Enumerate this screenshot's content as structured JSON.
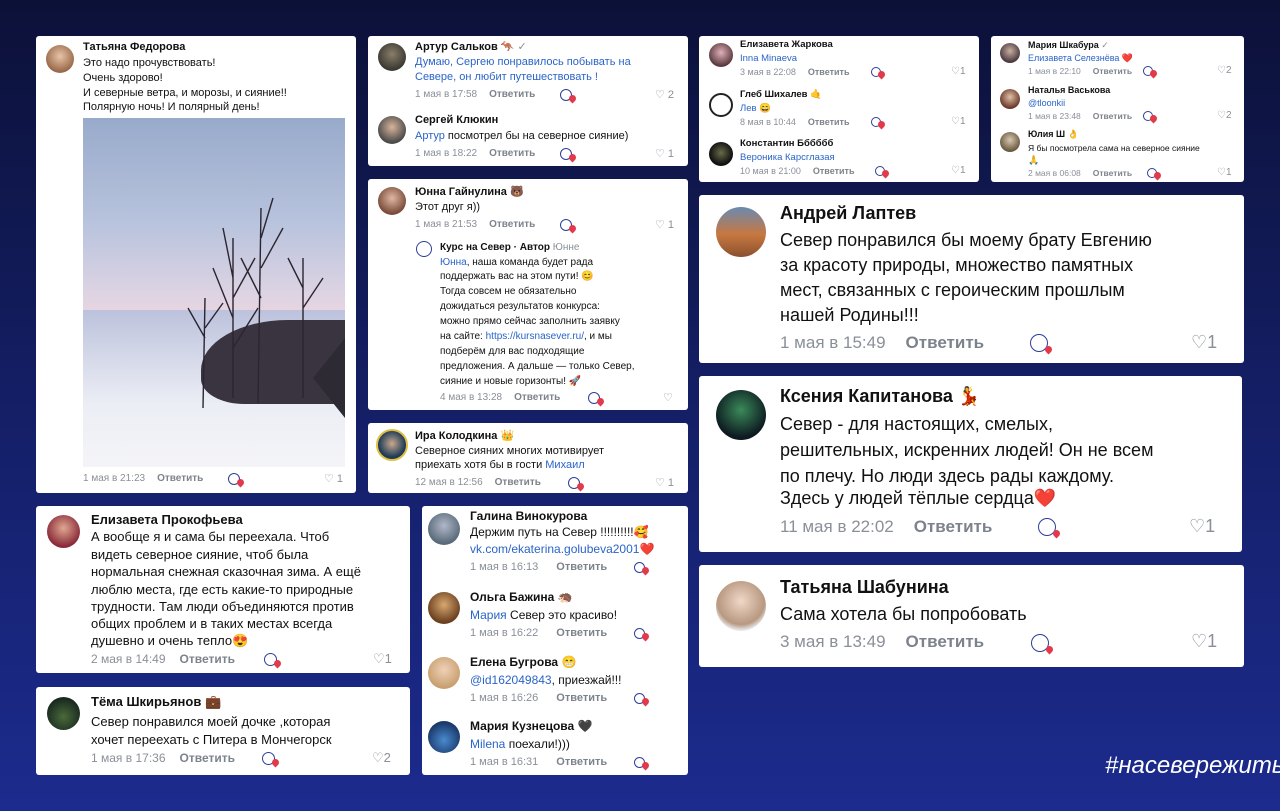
{
  "hashtag": "#насевережить",
  "reply_label": "Ответить",
  "c1": {
    "name": "Татьяна Федорова",
    "lines": [
      "Это надо прочувствовать!",
      "Очень здорово!",
      "И северные ветра, и морозы, и сияние!!",
      "Полярную ночь! И полярный день!"
    ],
    "date": "1 мая в 21:23",
    "likes": "1"
  },
  "c2a": {
    "name": "Артур Сальков",
    "line1": "Думаю, Сергею понравилось побывать на",
    "line2": "Севере, он любит путешествовать !",
    "date": "1 мая в 17:58",
    "likes": "2"
  },
  "c2b": {
    "name": "Сергей Клюкин",
    "mention": "Артур",
    "text": " посмотрел бы на северное сияние)",
    "date": "1 мая в 18:22",
    "likes": "1"
  },
  "c3": {
    "name": "Юнна Гайнулина",
    "text": "Этот друг я))",
    "date": "1 мая в 21:53",
    "likes": "1",
    "reply": {
      "name": "Курс на Север · Автор",
      "to": "Юнне",
      "mention": "Юнна",
      "lines": [
        ", наша команда будет рада",
        "поддержать вас на этом пути! 😊",
        "Тогда совсем не обязательно",
        "дожидаться результатов конкурса:",
        "можно прямо сейчас заполнить заявку",
        "на сайте: "
      ],
      "link": "https://kursnasever.ru/",
      "after_link": ", и мы",
      "lines2": [
        "подберём для вас подходящие",
        "предложения. А дальше — только Север,",
        "сияние и новые горизонты! 🚀"
      ],
      "date": "4 мая в 13:28"
    }
  },
  "c4": {
    "name": "Ира Колодкина",
    "line1": "Северное сияних многих мотивирует",
    "line2": "приехать хотя бы в гости ",
    "mention": "Михаил",
    "date": "12 мая в 12:56",
    "likes": "1"
  },
  "c5": [
    {
      "name": "Елизавета Жаркова",
      "mention": "Inna Minaeva",
      "date": "3 мая в 22:08",
      "likes": "1"
    },
    {
      "name": "Глеб Шихалев",
      "mention": "Лев 😄",
      "date": "8 мая в 10:44",
      "likes": "1"
    },
    {
      "name": "Константин Бббббб",
      "mention": "Вероника Карсглазая",
      "date": "10 мая в 21:00",
      "likes": "1"
    }
  ],
  "c6": [
    {
      "name": "Мария Шкабура",
      "mention": "Елизавета Селезнёва ❤️",
      "date": "1 мая в 22:10",
      "likes": "2"
    },
    {
      "name": "Наталья Васькова",
      "mention": "@tloonkii",
      "date": "1 мая в 23:48",
      "likes": "2"
    },
    {
      "name": "Юлия Ш",
      "text": "Я бы посмотрела сама на северное сияние",
      "text2": "🙏",
      "date": "2 мая в 06:08",
      "likes": "1"
    }
  ],
  "c7": {
    "name": "Андрей Лаптев",
    "lines": [
      "Север понравился бы моему брату Евгению",
      "за красоту природы, множество памятных",
      "мест, связанных с героическим прошлым",
      "нашей Родины!!!"
    ],
    "date": "1 мая в 15:49",
    "likes": "1"
  },
  "c8": {
    "name": "Ксения Капитанова",
    "lines": [
      "Север -  для настоящих, смелых,",
      "решительных, искренних людей! Он не всем",
      "по плечу. Но люди здесь рады каждому.",
      "Здесь у людей тёплые сердца❤️"
    ],
    "date": "11 мая в 22:02",
    "likes": "1"
  },
  "c9": {
    "name": "Татьяна Шабунина",
    "text": "Сама хотела бы попробовать",
    "date": "3 мая в 13:49",
    "likes": "1"
  },
  "c10": {
    "name": "Елизавета Прокофьева",
    "lines": [
      "А вообще я и сама бы переехала. Чтоб",
      "видеть северное сияние, чтоб была",
      "нормальная снежная сказочная зима. А ещё",
      "люблю места, где есть какие-то природные",
      "трудности. Там люди объединяются против",
      "общих проблем и в таких местах всегда",
      "душевно и очень тепло😍"
    ],
    "date": "2 мая в 14:49",
    "likes": "1"
  },
  "c11": {
    "name": "Тёма Шкирьянов",
    "line1": "Север понравился моей дочке ,которая",
    "line2": "хочет переехать с Питера в Мончегорск",
    "date": "1 мая в 17:36",
    "likes": "2"
  },
  "c12": [
    {
      "name": "Галина Винокурова",
      "text": "Держим путь на Север !!!!!!!!!!🥰",
      "link": "vk.com/ekaterina.golubeva2001",
      "date": "1 мая в 16:13"
    },
    {
      "name": "Ольга Бажина",
      "mention": "Мария",
      "text": "  Север это красиво!",
      "date": "1 мая в 16:22"
    },
    {
      "name": "Елена Бугрова",
      "mention": "@id162049843",
      "text": ", приезжай!!!",
      "date": "1 мая в 16:26"
    },
    {
      "name": "Мария Кузнецова",
      "mention": "Milena",
      "text": " поехали!)))",
      "date": "1 мая в 16:31"
    }
  ]
}
